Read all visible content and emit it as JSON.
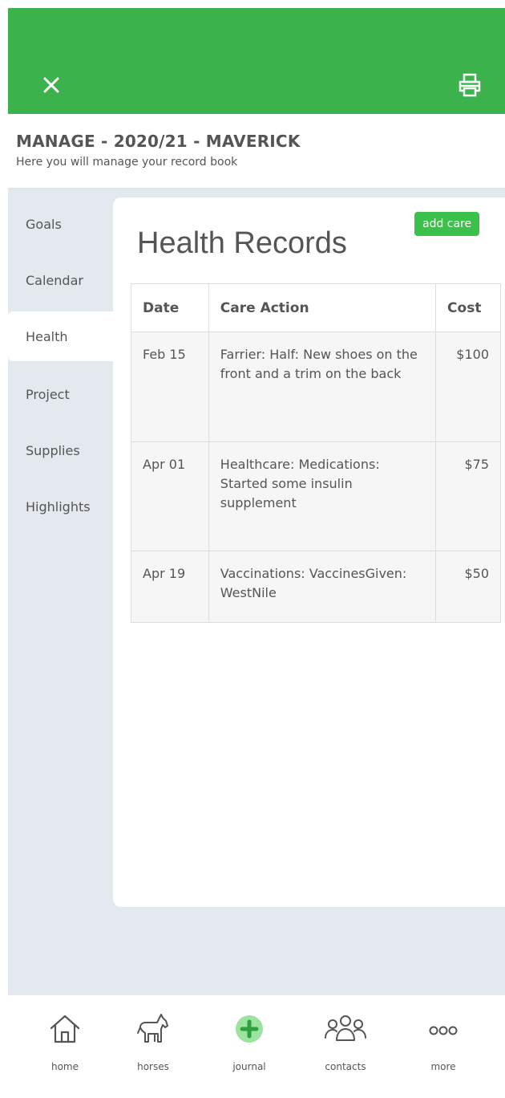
{
  "header": {
    "close_icon": "close-icon",
    "print_icon": "print-icon",
    "bar_color": "#3bb24c"
  },
  "manage": {
    "title": "MANAGE - 2020/21 - MAVERICK",
    "subtitle": "Here you will manage your record book"
  },
  "sidebar": {
    "items": [
      {
        "label": "Goals",
        "active": false
      },
      {
        "label": "Calendar",
        "active": false
      },
      {
        "label": "Health",
        "active": true
      },
      {
        "label": "Project",
        "active": false
      },
      {
        "label": "Supplies",
        "active": false
      },
      {
        "label": "Highlights",
        "active": false
      }
    ]
  },
  "main": {
    "title": "Health Records",
    "add_button": "add care",
    "table": {
      "headers": [
        "Date",
        "Care Action",
        "Cost"
      ],
      "rows": [
        {
          "date": "Feb 15",
          "action": "Farrier: Half: New shoes on the front and a trim on the back",
          "cost": "$100"
        },
        {
          "date": "Apr 01",
          "action": "Healthcare: Medications: Started some insulin supplement",
          "cost": "$75"
        },
        {
          "date": "Apr 19",
          "action": "Vaccinations: VaccinesGiven: WestNile",
          "cost": "$50"
        }
      ]
    }
  },
  "tabbar": {
    "items": [
      {
        "label": "home",
        "icon": "home-icon"
      },
      {
        "label": "horses",
        "icon": "horse-icon"
      },
      {
        "label": "journal",
        "icon": "plus-circle-icon"
      },
      {
        "label": "contacts",
        "icon": "people-icon"
      },
      {
        "label": "more",
        "icon": "more-icon"
      }
    ]
  }
}
